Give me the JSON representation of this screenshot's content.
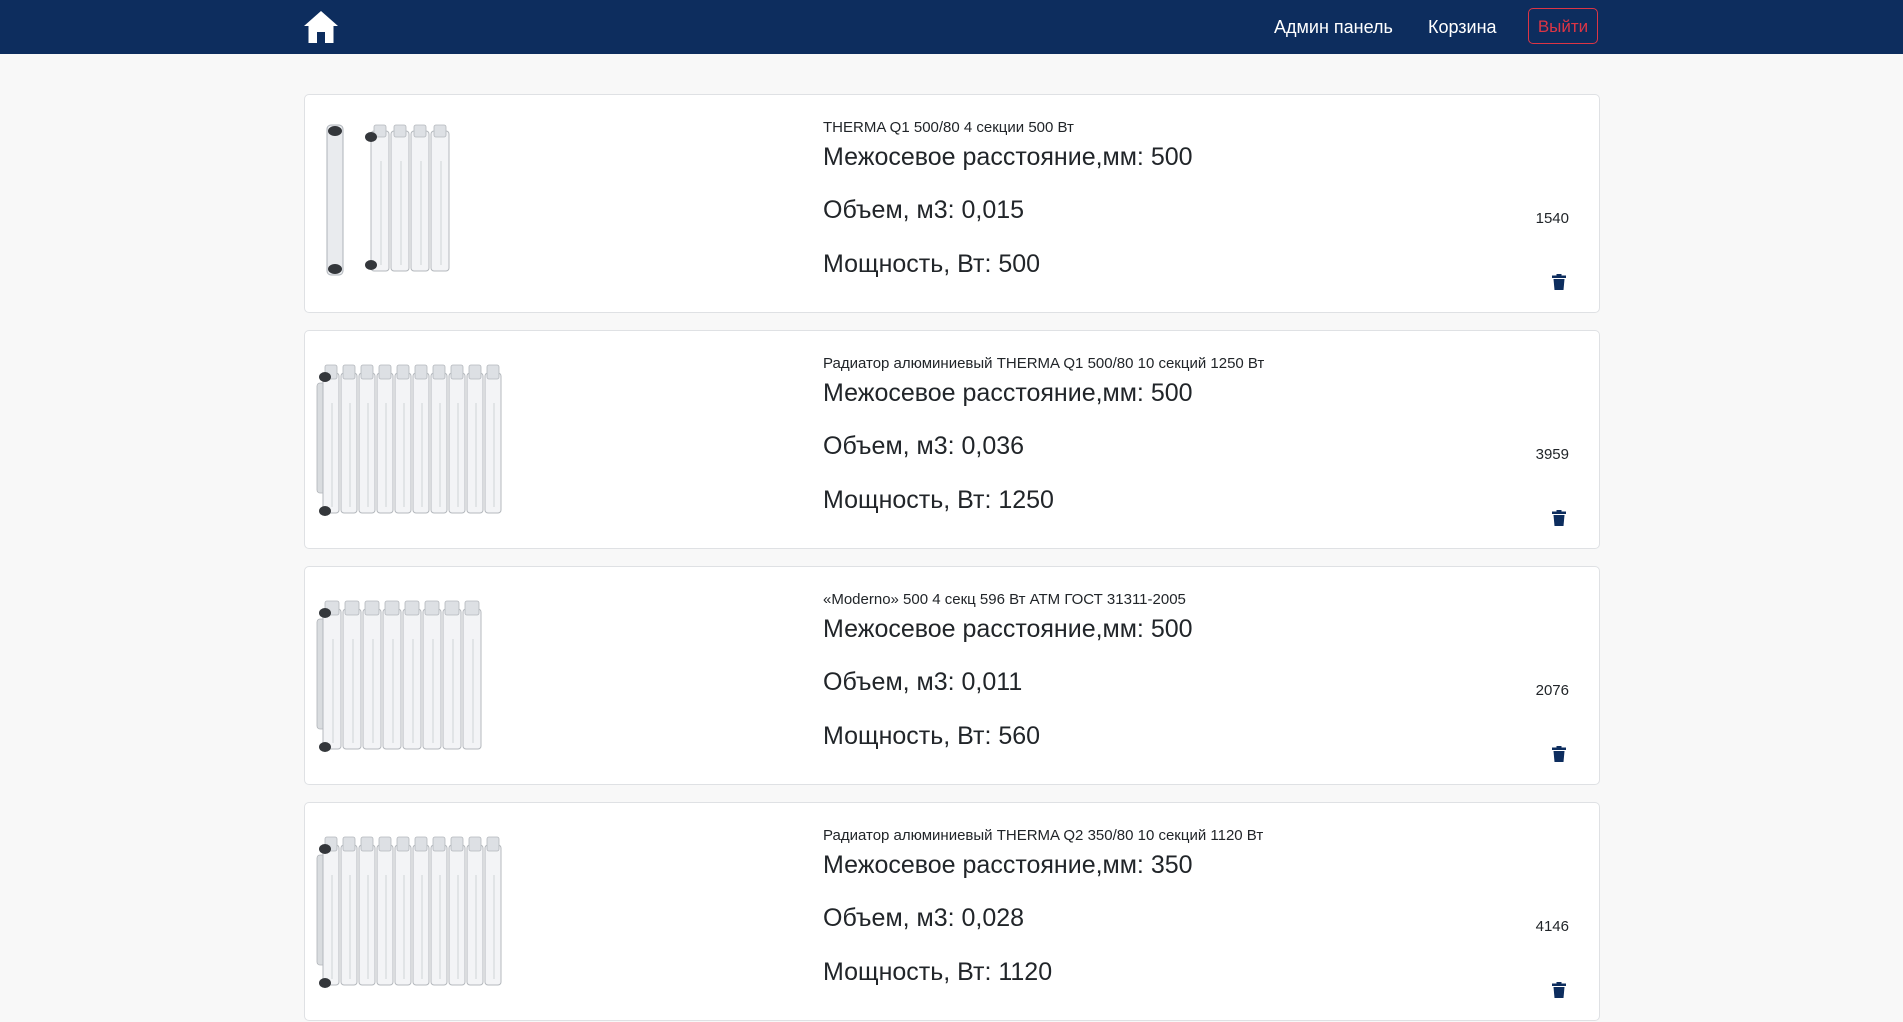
{
  "nav": {
    "home_icon": "home-icon",
    "admin_label": "Админ панель",
    "cart_label": "Корзина",
    "logout_label": "Выйти"
  },
  "colors": {
    "navbar_bg": "#0d2d5e",
    "logout": "#dc3545",
    "trash_icon": "#0d2d5e"
  },
  "products": [
    {
      "title": "THERMA Q1 500/80 4 секции 500 Вт",
      "spec_distance": "Межосевое расстояние,мм: 500",
      "spec_volume": "Объем, м3: 0,015",
      "spec_power": "Мощность, Вт: 500",
      "price": "1540",
      "sections": 4
    },
    {
      "title": "Радиатор алюминиевый THERMA Q1 500/80 10 секций 1250 Вт",
      "spec_distance": "Межосевое расстояние,мм: 500",
      "spec_volume": "Объем, м3: 0,036",
      "spec_power": "Мощность, Вт: 1250",
      "price": "3959",
      "sections": 10
    },
    {
      "title": "«Moderno» 500 4 секц 596 Вт АТМ ГОСТ 31311-2005",
      "spec_distance": "Межосевое расстояние,мм: 500",
      "spec_volume": "Объем, м3: 0,011",
      "spec_power": "Мощность, Вт: 560",
      "price": "2076",
      "sections": 8
    },
    {
      "title": "Радиатор алюминиевый THERMA Q2 350/80 10 секций 1120 Вт",
      "spec_distance": "Межосевое расстояние,мм: 350",
      "spec_volume": "Объем, м3: 0,028",
      "spec_power": "Мощность, Вт: 1120",
      "price": "4146",
      "sections": 10
    }
  ]
}
